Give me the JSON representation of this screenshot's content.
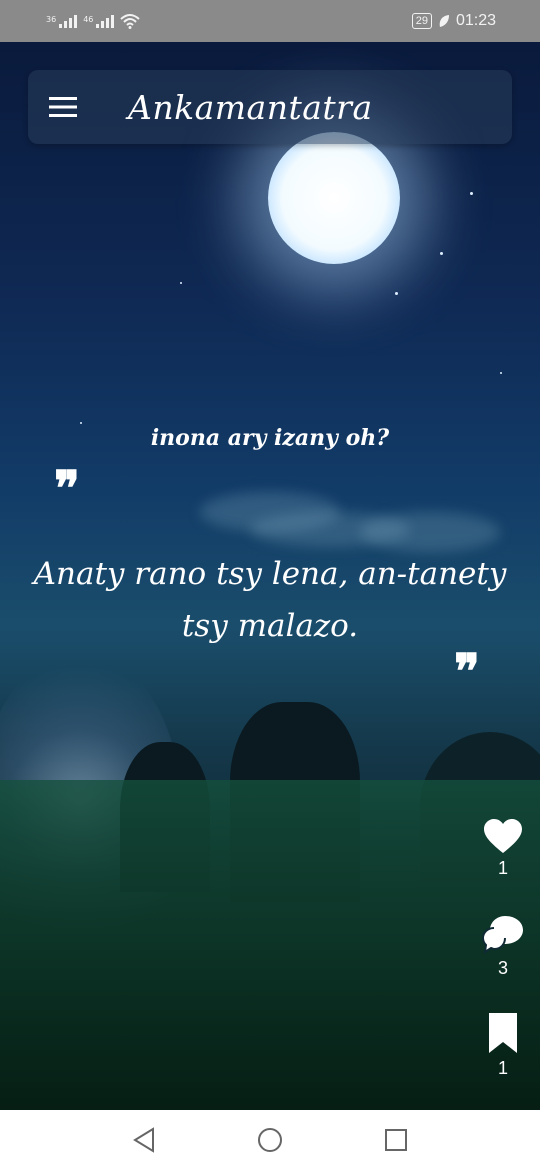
{
  "status_bar": {
    "signal1": "36",
    "signal2": "46",
    "battery": "29",
    "time": "01:23"
  },
  "app": {
    "title": "Ankamantatra"
  },
  "riddle": {
    "question": "inona ary izany oh?",
    "quote_open": "❞",
    "quote_close": "❞",
    "text": "Anaty rano tsy lena, an-tanety tsy malazo."
  },
  "actions": {
    "likes": "1",
    "comments": "3",
    "bookmarks": "1"
  },
  "icons": [
    "menu-icon",
    "heart-icon",
    "comment-icon",
    "bookmark-icon",
    "back-icon",
    "home-icon",
    "recents-icon",
    "wifi-icon",
    "signal-icon",
    "battery-icon",
    "leaf-icon"
  ]
}
